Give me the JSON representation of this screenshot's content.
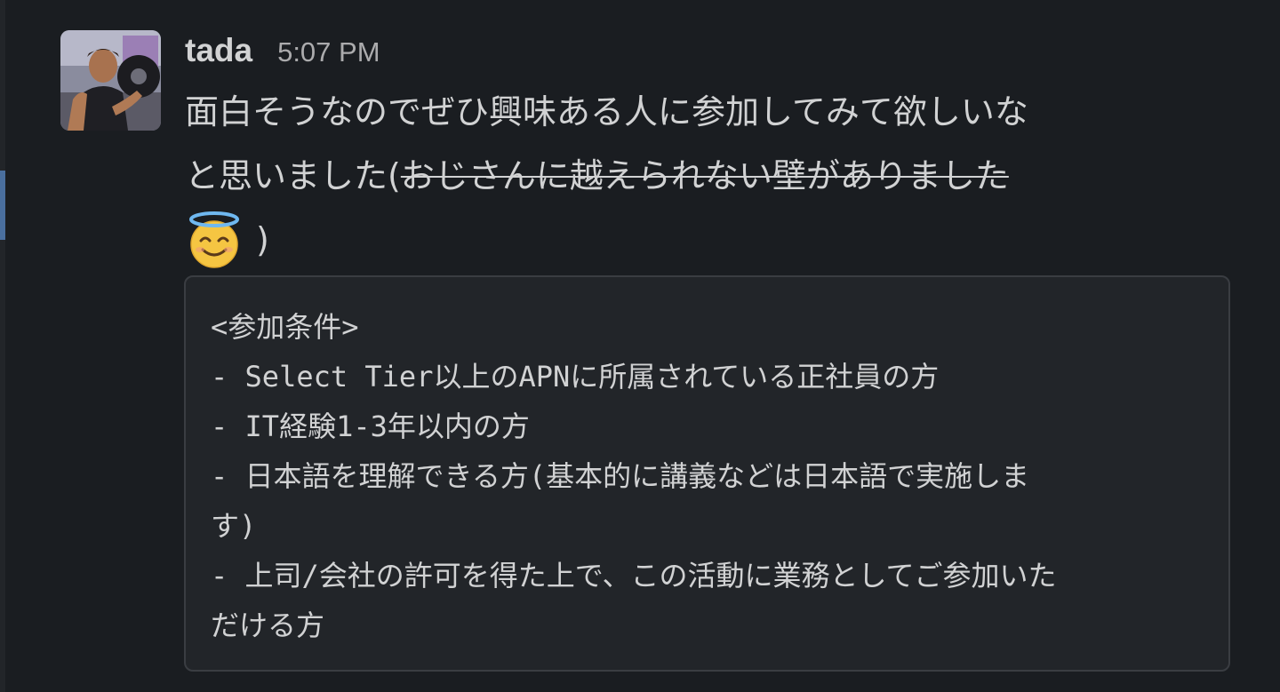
{
  "message": {
    "author": "tada",
    "timestamp": "5:07 PM",
    "avatar_icon": "user-avatar-photo",
    "text": {
      "line1": "面白そうなのでぜひ興味ある人に参加してみて欲しいな",
      "line2_plain": "と思いました(",
      "line2_strikethrough": "おじさんに越えられない壁がありました",
      "emoji": "innocent-halo-emoji",
      "line3_after_emoji": ")"
    },
    "code_block": {
      "lines": [
        "<参加条件>",
        "- Select Tier以上のAPNに所属されている正社員の方",
        "- IT経験1-3年以内の方",
        "- 日本語を理解できる方(基本的に講義などは日本語で実施しま",
        "す)",
        "- 上司/会社の許可を得た上で、この活動に業務としてご参加いた",
        "だける方"
      ]
    }
  },
  "colors": {
    "background": "#1a1d21",
    "text": "#d1d2d3",
    "timestamp": "#ababad",
    "code_background": "#222529",
    "code_border": "#3a3d42",
    "left_accent": "#4a6f9e"
  }
}
